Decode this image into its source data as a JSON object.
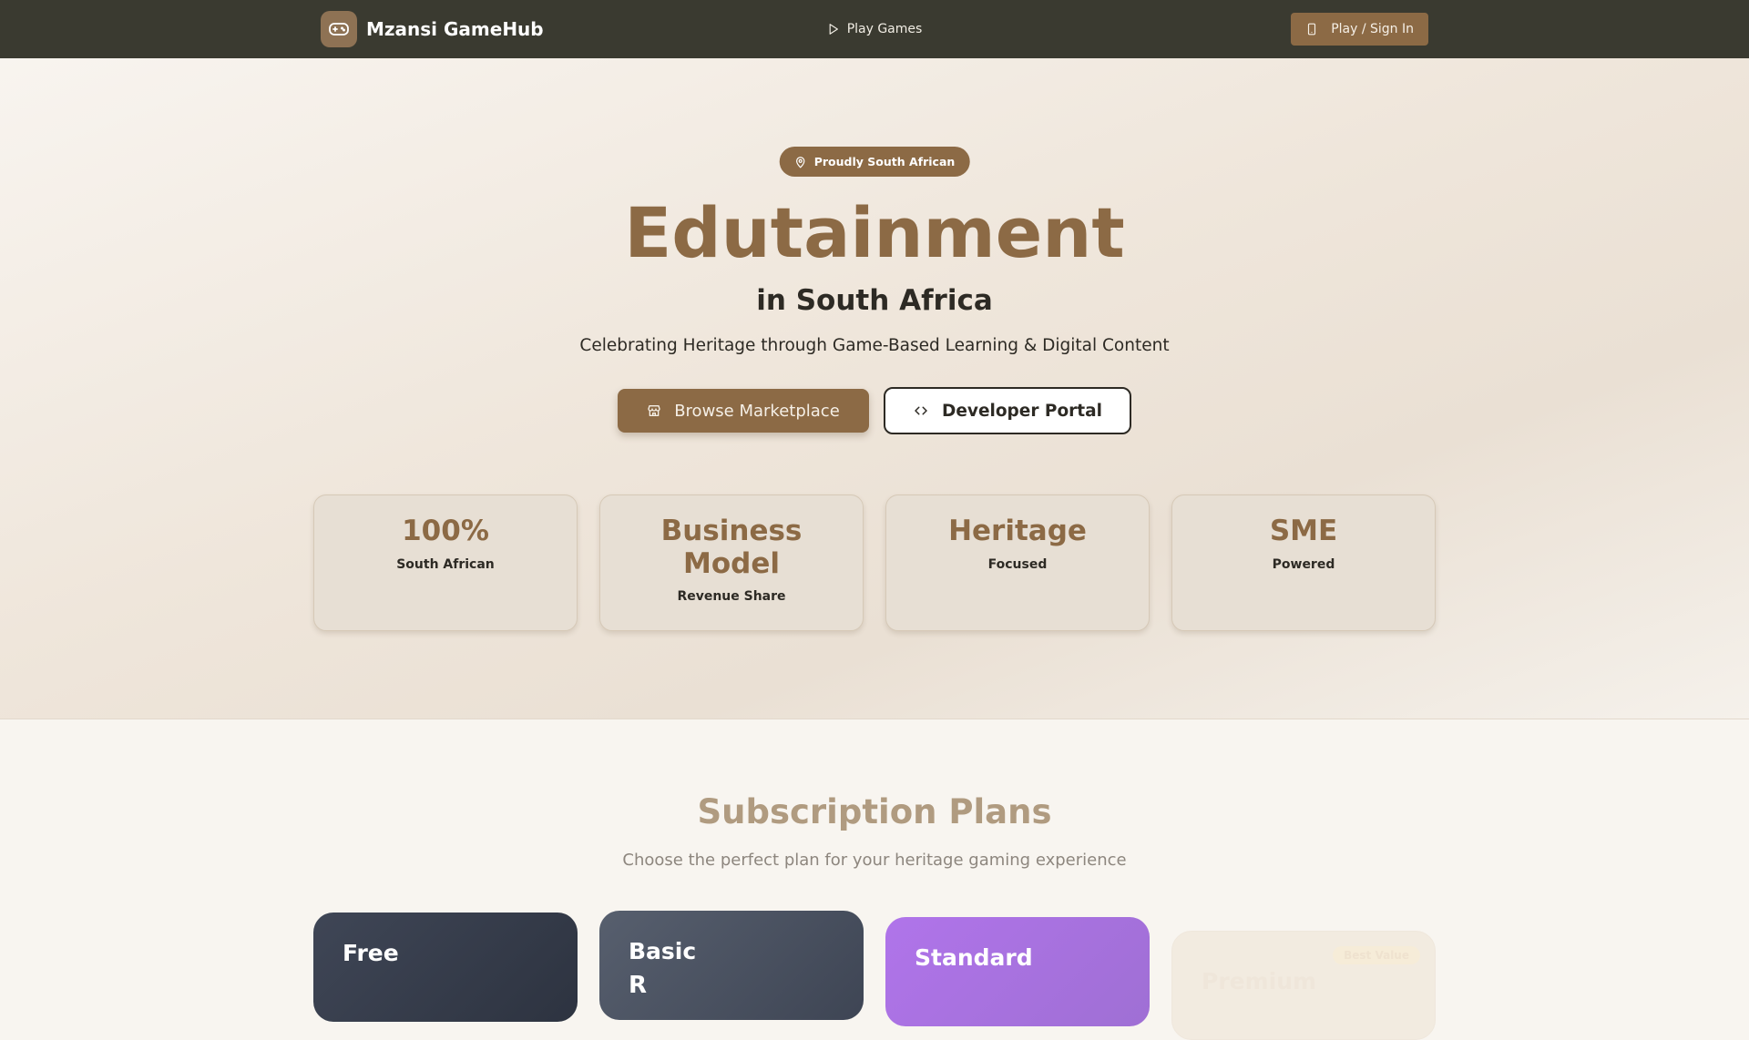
{
  "nav": {
    "brand": "Mzansi GameHub",
    "play_games": "Play Games",
    "cta": "Play / Sign In"
  },
  "hero": {
    "badge": "Proudly South African",
    "title": "Edutainment",
    "subtitle": "in South Africa",
    "description": "Celebrating Heritage through Game-Based Learning & Digital Content",
    "browse_button": "Browse Marketplace",
    "developer_button": "Developer Portal"
  },
  "stats": [
    {
      "value": "100%",
      "label": "South African"
    },
    {
      "value": "Business Model",
      "label": "Revenue Share"
    },
    {
      "value": "Heritage",
      "label": "Focused"
    },
    {
      "value": "SME",
      "label": "Powered"
    }
  ],
  "plans": {
    "title": "Subscription Plans",
    "description": "Choose the perfect plan for your heritage gaming experience",
    "items": [
      {
        "name": "Free"
      },
      {
        "name": "Basic",
        "price": "R [partially visible]"
      },
      {
        "name": "Standard"
      },
      {
        "name": "Premium",
        "badge": "Best Value"
      }
    ]
  },
  "colors": {
    "nav_bg": "#3a3a30",
    "accent": "#8c6a45",
    "text_dark": "#2d2a24",
    "standard_purple": "#b074ea"
  }
}
